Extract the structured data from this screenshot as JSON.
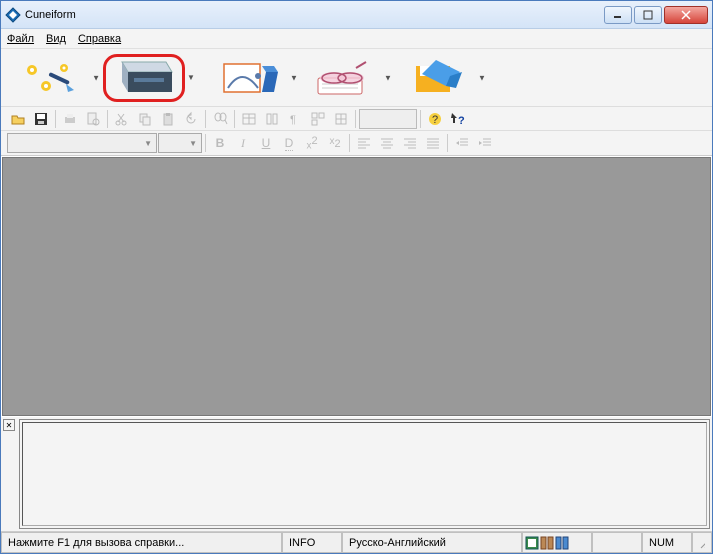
{
  "titlebar": {
    "title": "Cuneiform"
  },
  "menubar": {
    "file": "Файл",
    "view": "Вид",
    "help": "Справка"
  },
  "main_toolbar": {
    "wizard": "wizard",
    "scan": "scan",
    "recognize": "recognize",
    "spellcheck": "spellcheck",
    "save": "save"
  },
  "small_toolbar": {
    "open": "open",
    "save": "save",
    "print": "print",
    "preview": "preview",
    "cut": "cut",
    "copy": "copy",
    "paste": "paste",
    "undo": "undo",
    "find": "find",
    "table": "table",
    "column": "column",
    "para": "para",
    "boxes": "boxes",
    "grid": "grid",
    "help_q": "?",
    "help_arrow": "?"
  },
  "format_toolbar": {
    "font_name": "",
    "font_size": "",
    "bold": "B",
    "italic": "I",
    "underline": "U",
    "dotted_underline": "D",
    "superscript": "x²",
    "subscript": "x₂",
    "align_left": "L",
    "align_center": "C",
    "align_right": "R",
    "align_justify": "J",
    "indent_decrease": "<",
    "indent_increase": ">"
  },
  "statusbar": {
    "hint": "Нажмите F1 для вызова справки...",
    "info": "INFO",
    "language": "Русско-Английский",
    "num": "NUM"
  }
}
